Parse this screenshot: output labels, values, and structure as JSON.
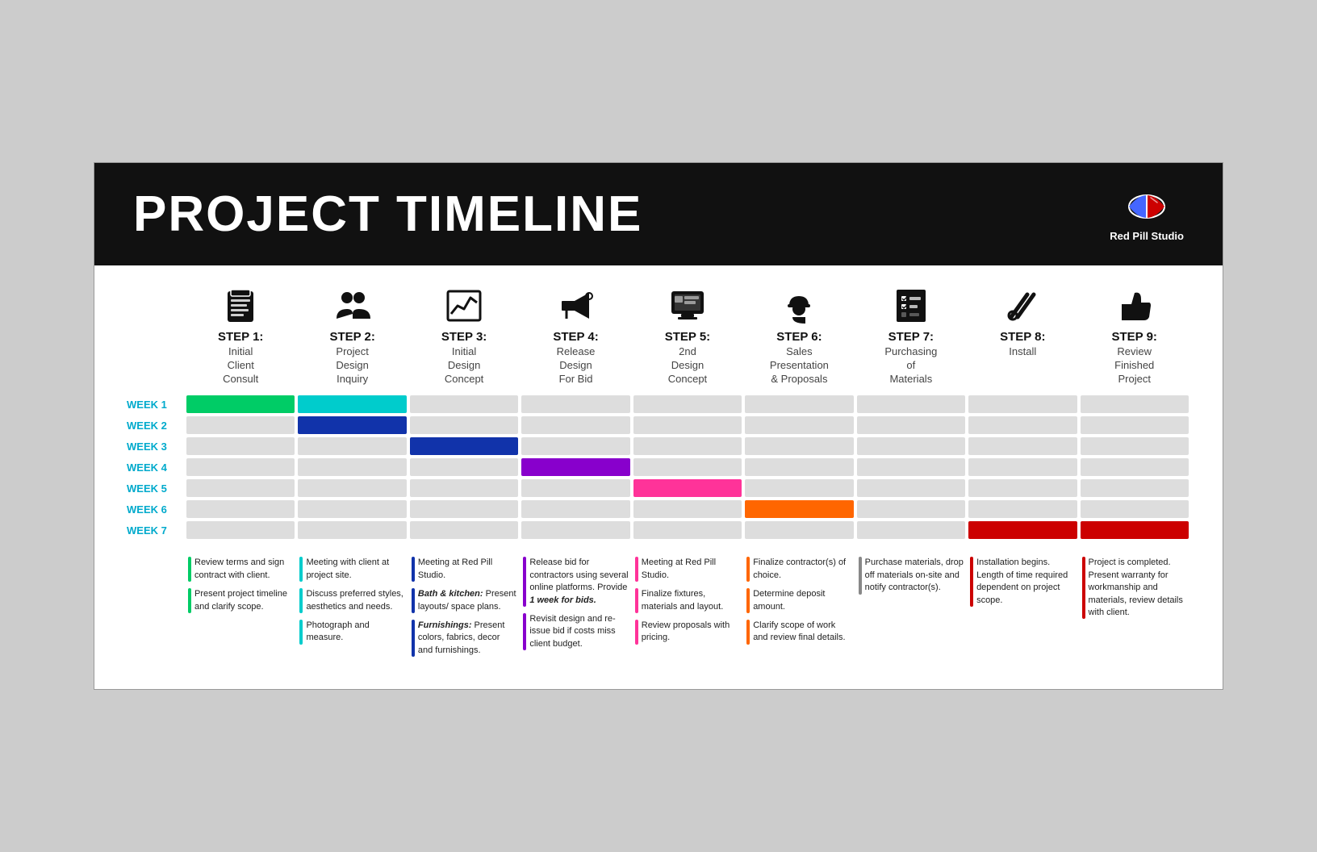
{
  "header": {
    "title": "PROJECT TIMELINE",
    "logo_text": "Red Pill Studio"
  },
  "steps": [
    {
      "id": 1,
      "label": "STEP 1:",
      "name": "Initial\nClient\nConsult",
      "icon": "📋"
    },
    {
      "id": 2,
      "label": "STEP 2:",
      "name": "Project\nDesign\nInquiry",
      "icon": "👥"
    },
    {
      "id": 3,
      "label": "STEP 3:",
      "name": "Initial\nDesign\nConcept",
      "icon": "📈"
    },
    {
      "id": 4,
      "label": "STEP 4:",
      "name": "Release\nDesign\nFor Bid",
      "icon": "📣"
    },
    {
      "id": 5,
      "label": "STEP 5:",
      "name": "2nd\nDesign\nConcept",
      "icon": "🖥"
    },
    {
      "id": 6,
      "label": "STEP 6:",
      "name": "Sales\nPresentation\n& Proposals",
      "icon": "👷"
    },
    {
      "id": 7,
      "label": "STEP 7:",
      "name": "Purchasing\nof\nMaterials",
      "icon": "☑"
    },
    {
      "id": 8,
      "label": "STEP 8:",
      "name": "Install",
      "icon": "🔧"
    },
    {
      "id": 9,
      "label": "STEP 9:",
      "name": "Review\nFinished\nProject",
      "icon": "👍"
    }
  ],
  "weeks": [
    "WEEK 1",
    "WEEK 2",
    "WEEK 3",
    "WEEK 4",
    "WEEK 5",
    "WEEK 6",
    "WEEK 7"
  ],
  "timeline": {
    "rows": [
      {
        "week": "WEEK 1",
        "bars": [
          {
            "col": 0,
            "color": "#00CC66"
          },
          {
            "col": 1,
            "color": "#00CCCC"
          }
        ]
      },
      {
        "week": "WEEK 2",
        "bars": [
          {
            "col": 1,
            "color": "#1133AA"
          }
        ]
      },
      {
        "week": "WEEK 3",
        "bars": [
          {
            "col": 2,
            "color": "#1133AA"
          }
        ]
      },
      {
        "week": "WEEK 4",
        "bars": [
          {
            "col": 3,
            "color": "#8800CC"
          }
        ]
      },
      {
        "week": "WEEK 5",
        "bars": [
          {
            "col": 4,
            "color": "#FF3399"
          }
        ]
      },
      {
        "week": "WEEK 6",
        "bars": [
          {
            "col": 5,
            "color": "#FF6600"
          }
        ]
      },
      {
        "week": "WEEK 7",
        "bars": [
          {
            "col": 7,
            "color": "#CC0000"
          },
          {
            "col": 8,
            "color": "#CC0000"
          }
        ]
      }
    ]
  },
  "notes": [
    {
      "step": 1,
      "items": [
        {
          "color": "#00CC66",
          "text": "Review terms and sign contract with client."
        },
        {
          "color": "#00CC66",
          "text": "Present project timeline and clarify scope."
        }
      ]
    },
    {
      "step": 2,
      "items": [
        {
          "color": "#00CCCC",
          "text": "Meeting with client at project site."
        },
        {
          "color": "#00CCCC",
          "text": "Discuss preferred styles, aesthetics and needs."
        },
        {
          "color": "#00CCCC",
          "text": "Photograph and measure."
        }
      ]
    },
    {
      "step": 3,
      "items": [
        {
          "color": "#1133AA",
          "text": "Meeting at Red Pill Studio."
        },
        {
          "color": "#1133AA",
          "text": "Bath & kitchen: Present layouts/ space plans."
        },
        {
          "color": "#1133AA",
          "text": "Furnishings: Present colors, fabrics, decor and furnishings."
        }
      ]
    },
    {
      "step": 4,
      "items": [
        {
          "color": "#8800CC",
          "text": "Release bid for contractors using several online platforms. Provide 1 week for bids."
        },
        {
          "color": "#8800CC",
          "text": "Revisit design and re-issue bid if costs miss client budget."
        }
      ]
    },
    {
      "step": 5,
      "items": [
        {
          "color": "#FF3399",
          "text": "Meeting at Red Pill Studio."
        },
        {
          "color": "#FF3399",
          "text": "Finalize fixtures, materials and layout."
        },
        {
          "color": "#FF3399",
          "text": "Review proposals with pricing."
        }
      ]
    },
    {
      "step": 6,
      "items": [
        {
          "color": "#FF6600",
          "text": "Finalize contractor(s) of choice."
        },
        {
          "color": "#FF6600",
          "text": "Determine deposit amount."
        },
        {
          "color": "#FF6600",
          "text": "Clarify scope of work and review final details."
        }
      ]
    },
    {
      "step": 7,
      "items": [
        {
          "color": "#888888",
          "text": "Purchase materials, drop off materials on-site and notify contractor(s)."
        }
      ]
    },
    {
      "step": 8,
      "items": [
        {
          "color": "#CC0000",
          "text": "Installation begins. Length of time required dependent on project scope."
        }
      ]
    },
    {
      "step": 9,
      "items": [
        {
          "color": "#CC0000",
          "text": "Project is completed. Present warranty for workmanship and materials, review details with client."
        }
      ]
    }
  ]
}
